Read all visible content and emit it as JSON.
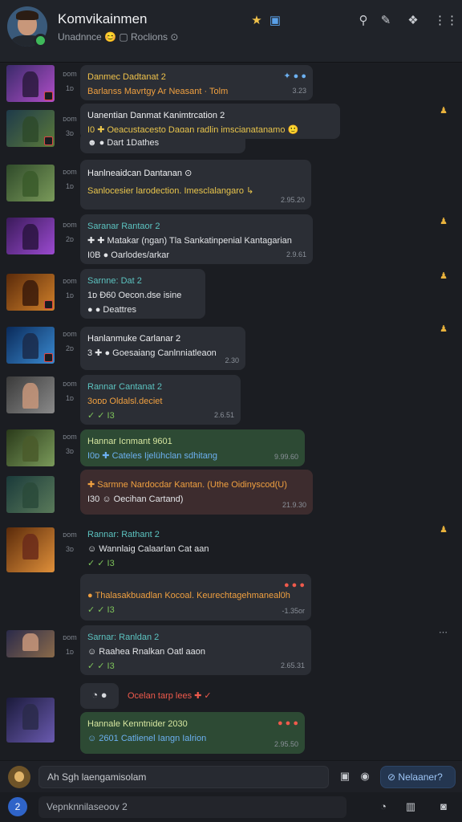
{
  "header": {
    "title": "Komvikainmen",
    "subtitle": "Unadnnce 😊 ▢ Roclions ⊙",
    "icons": {
      "star": "★",
      "badge": "▣",
      "search": "⚲",
      "edit": "✎",
      "pin": "❖",
      "more": "⋮⋮"
    }
  },
  "messages": [
    {
      "meta": [
        "ᴅom",
        "1ᴅ"
      ],
      "title": "Danmec Dadtanat 2",
      "lines": [
        "Barlanss Mavrtgy Ar Neasant · Tolm"
      ],
      "tag": "✦ ● ●",
      "time": "3.23"
    },
    {
      "meta": [
        "ᴅom",
        "3ᴅ"
      ],
      "title": "Uanentian Danmat Kanimtrcation 2",
      "lines": [
        "I0 ✚ Oeacustacesto Dagan  radlin   imscianatanamo 🙂",
        "☻ ● Dart 1Dathes"
      ],
      "tag": "",
      "time": ""
    },
    {
      "meta": [
        "ᴅom",
        "1ᴅ"
      ],
      "title": "Hanlneaidcan Dantanan ⊙",
      "lines": [
        "Sanlocesier larodection.   Imesclalangaro ↳"
      ],
      "tag": "",
      "time": "2.95.20"
    },
    {
      "meta": [
        "ᴅom",
        "2ᴅ"
      ],
      "title": "Saranar Rantaor 2",
      "lines": [
        "✚ ✚ Matakar (ngan) Tla Sankatinpenial Kantagarian",
        "I0B ● Oarlodes/arkar"
      ],
      "tag": "",
      "time": "2.9.61"
    },
    {
      "meta": [
        "ᴅom",
        "1ᴅ"
      ],
      "title": "Sarnne: Dat 2",
      "lines": [
        "1ᴅ  Ð60 Oecon.dse isine",
        "● ● Deattres"
      ],
      "tag": "",
      "time": ""
    },
    {
      "meta": [
        "ᴅom",
        "2ᴅ"
      ],
      "title": "Hanlanmuke Carlanar 2",
      "lines": [
        "3 ✚ ● Goesaiang Canlnniatleaon"
      ],
      "tag": "",
      "time": "2.30"
    },
    {
      "meta": [
        "ᴅom",
        "1ᴅ"
      ],
      "title": "Rannar Cantanat 2",
      "lines": [
        "3oᴅᴅ Oldalsl.deciet",
        "✓ ✓ I3"
      ],
      "tag": "",
      "time": "2.6.51"
    },
    {
      "meta": [
        "ᴅom",
        "3ᴅ"
      ],
      "title": "Hannar Icnmant 9601",
      "lines": [
        "I0ᴅ ✚ Cateles Ijelühclan sdhitang"
      ],
      "tag": "",
      "time": "9.99.60"
    },
    {
      "meta": [
        "",
        ""
      ],
      "title": "✚  Sarmne Nardocdar Kantan.  (Uthe Oidinyscod(U)",
      "lines": [
        "I30 ☺ Oecihan Cartand)"
      ],
      "tag": "",
      "time": "21.9.30"
    },
    {
      "meta": [
        "ᴅom",
        "3ᴅ"
      ],
      "title": "Rannar: Rathant 2",
      "lines": [
        "☺ Wannlaig Calaarlan Cat aan",
        "✓ ✓ I3"
      ],
      "tag": "",
      "time": ""
    },
    {
      "meta": [
        "",
        ""
      ],
      "title": "● Thalasakbuadlan Kocoal.   Keurechtagehmaneal0h",
      "lines": [
        "✓ ✓ I3"
      ],
      "tag": "● ● ●",
      "time": "-1.35or"
    },
    {
      "meta": [
        "ᴅom",
        "1ᴅ"
      ],
      "title": "Sarnar: Ranldan 2",
      "lines": [
        "☺ Raahea Rnalkan Oatl aaon",
        "✓ ✓ I3"
      ],
      "tag": "",
      "time": "2.65.31"
    },
    {
      "meta": [
        "",
        ""
      ],
      "title": "Ocelan tarp lees ✚ ✓",
      "lines": [],
      "tag": "",
      "time": ""
    },
    {
      "meta": [
        "",
        ""
      ],
      "title": "Hannale Kenntnider 2030",
      "lines": [
        "☺ 2601 Catlienel Iangn Ialrion"
      ],
      "tag": "● ● ●",
      "time": "2.95.50"
    }
  ],
  "input": {
    "placeholder": "Ah Sgh laengamisolam",
    "send_label": "Nelaaner?",
    "icons": {
      "attach": "▣",
      "emoji": "◉",
      "send": "⊘"
    }
  },
  "bottom": {
    "channel": "2",
    "field": "Vepnknnilaseoov 2",
    "icons": {
      "gif": "◔",
      "sticker": "▥",
      "camera": "◙"
    }
  },
  "colors": {
    "accent": "#f0c24a",
    "green_bubble": "#2d4a34",
    "online": "#3fb95a",
    "send": "#243650"
  }
}
